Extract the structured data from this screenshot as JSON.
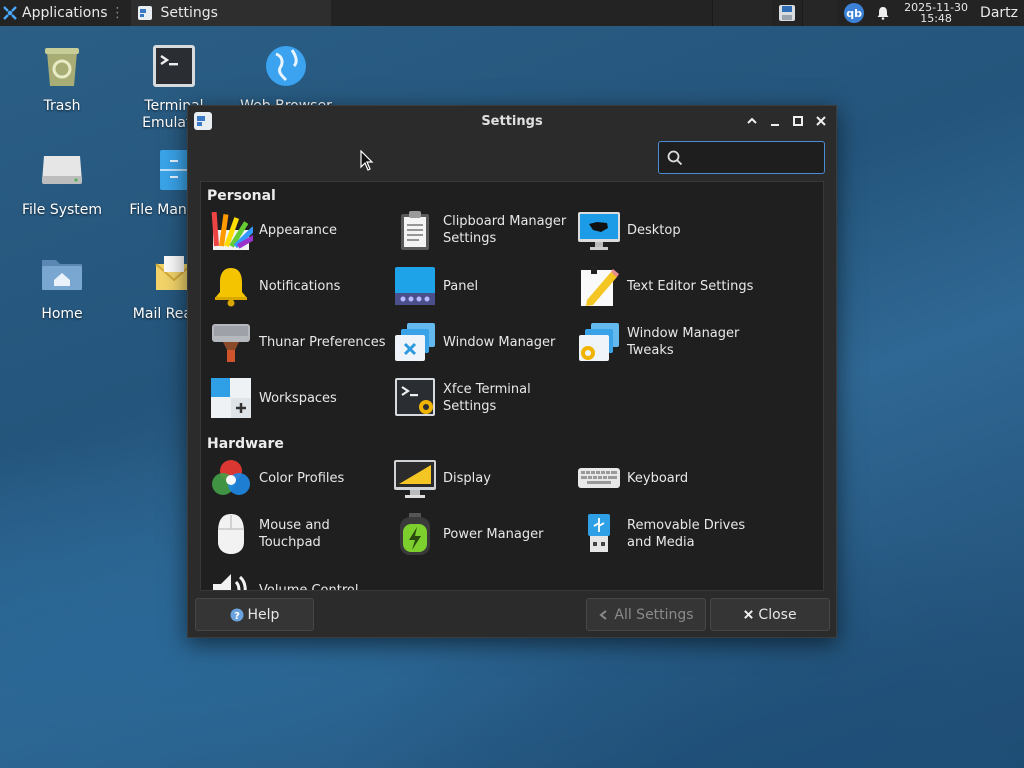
{
  "panel": {
    "applications_label": "Applications",
    "task_label": "Settings",
    "clock_date": "2025-11-30",
    "clock_time": "15:48",
    "user": "Dartz",
    "tray_badge": "qb"
  },
  "desktop": {
    "icons": [
      {
        "label": "Trash"
      },
      {
        "label": "Terminal Emulator"
      },
      {
        "label": "Web Browser"
      },
      {
        "label": "File System"
      },
      {
        "label": "File Manager"
      },
      {
        "label": "Home"
      },
      {
        "label": "Mail Reader"
      }
    ]
  },
  "window": {
    "title": "Settings",
    "search_placeholder": "",
    "sections": {
      "personal": "Personal",
      "hardware": "Hardware"
    },
    "personal_items": [
      {
        "label": "Appearance",
        "icon": "appearance-icon"
      },
      {
        "label": "Clipboard Manager Settings",
        "icon": "clipboard-icon"
      },
      {
        "label": "Desktop",
        "icon": "desktop-icon"
      },
      {
        "label": "Notifications",
        "icon": "bell-icon"
      },
      {
        "label": "Panel",
        "icon": "panel-icon"
      },
      {
        "label": "Text Editor Settings",
        "icon": "text-editor-icon"
      },
      {
        "label": "Thunar Preferences",
        "icon": "thunar-icon"
      },
      {
        "label": "Window Manager",
        "icon": "window-manager-icon"
      },
      {
        "label": "Window Manager Tweaks",
        "icon": "window-tweaks-icon"
      },
      {
        "label": "Workspaces",
        "icon": "workspaces-icon"
      },
      {
        "label": "Xfce Terminal Settings",
        "icon": "terminal-settings-icon"
      }
    ],
    "hardware_items": [
      {
        "label": "Color Profiles",
        "icon": "color-profiles-icon"
      },
      {
        "label": "Display",
        "icon": "display-icon"
      },
      {
        "label": "Keyboard",
        "icon": "keyboard-icon"
      },
      {
        "label": "Mouse and Touchpad",
        "icon": "mouse-icon"
      },
      {
        "label": "Power Manager",
        "icon": "battery-icon"
      },
      {
        "label": "Removable Drives and Media",
        "icon": "usb-icon"
      },
      {
        "label": "Volume Control",
        "icon": "volume-icon"
      }
    ],
    "buttons": {
      "help": "Help",
      "all_settings": "All Settings",
      "close": "Close"
    }
  },
  "colors": {
    "accent": "#4a8bd6",
    "window_bg": "#2b2b2b",
    "content_bg": "#1f1f1f",
    "panel_bg": "#232323"
  }
}
